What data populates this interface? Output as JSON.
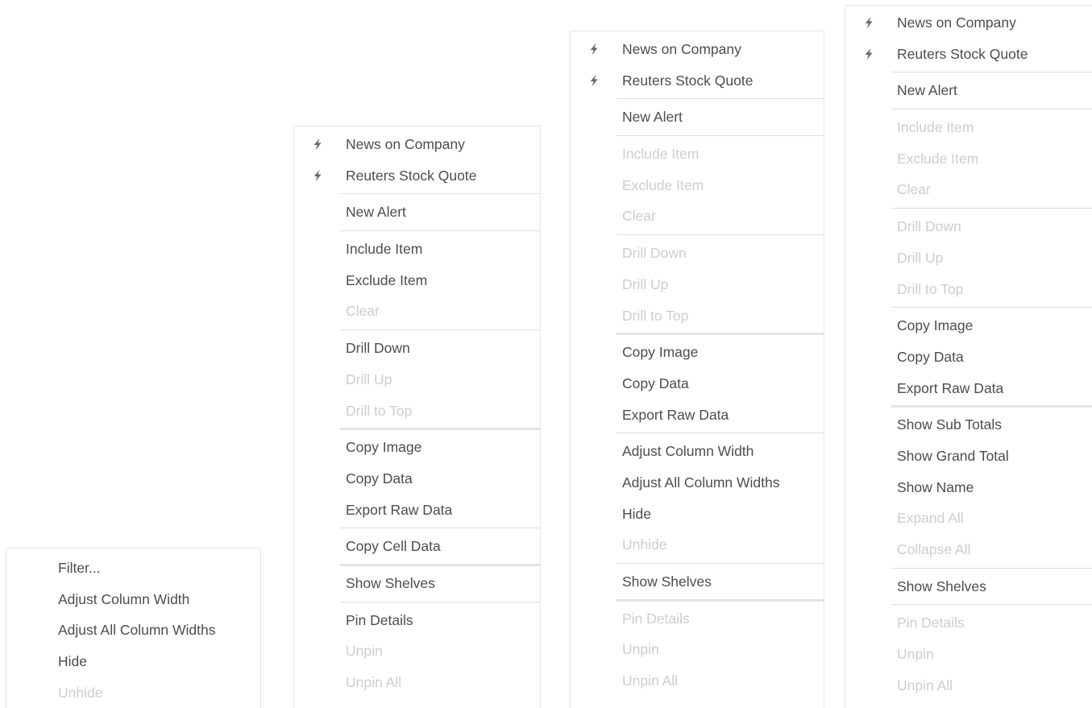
{
  "menus": [
    {
      "id": "menu-1",
      "items": [
        {
          "type": "item",
          "label": "Filter...",
          "enabled": true
        },
        {
          "type": "item",
          "label": "Adjust Column Width",
          "enabled": true
        },
        {
          "type": "item",
          "label": "Adjust All Column Widths",
          "enabled": true
        },
        {
          "type": "item",
          "label": "Hide",
          "enabled": true
        },
        {
          "type": "item",
          "label": "Unhide",
          "enabled": false
        }
      ]
    },
    {
      "id": "menu-2",
      "items": [
        {
          "type": "item",
          "label": "News on Company",
          "enabled": true,
          "icon": "lightning-icon"
        },
        {
          "type": "item",
          "label": "Reuters Stock Quote",
          "enabled": true,
          "icon": "lightning-icon"
        },
        {
          "type": "sep"
        },
        {
          "type": "item",
          "label": "New Alert",
          "enabled": true
        },
        {
          "type": "sep"
        },
        {
          "type": "item",
          "label": "Include Item",
          "enabled": true
        },
        {
          "type": "item",
          "label": "Exclude Item",
          "enabled": true
        },
        {
          "type": "item",
          "label": "Clear",
          "enabled": false
        },
        {
          "type": "sep"
        },
        {
          "type": "item",
          "label": "Drill Down",
          "enabled": true
        },
        {
          "type": "item",
          "label": "Drill Up",
          "enabled": false
        },
        {
          "type": "item",
          "label": "Drill to Top",
          "enabled": false
        },
        {
          "type": "sep",
          "style": "thick"
        },
        {
          "type": "item",
          "label": "Copy Image",
          "enabled": true
        },
        {
          "type": "item",
          "label": "Copy Data",
          "enabled": true
        },
        {
          "type": "item",
          "label": "Export Raw Data",
          "enabled": true
        },
        {
          "type": "sep"
        },
        {
          "type": "item",
          "label": "Copy Cell Data",
          "enabled": true
        },
        {
          "type": "sep",
          "style": "thick"
        },
        {
          "type": "item",
          "label": "Show Shelves",
          "enabled": true
        },
        {
          "type": "sep"
        },
        {
          "type": "item",
          "label": "Pin Details",
          "enabled": true
        },
        {
          "type": "item",
          "label": "Unpin",
          "enabled": false
        },
        {
          "type": "item",
          "label": "Unpin All",
          "enabled": false
        }
      ]
    },
    {
      "id": "menu-3",
      "items": [
        {
          "type": "item",
          "label": "News on Company",
          "enabled": true,
          "icon": "lightning-icon"
        },
        {
          "type": "item",
          "label": "Reuters Stock Quote",
          "enabled": true,
          "icon": "lightning-icon"
        },
        {
          "type": "sep"
        },
        {
          "type": "item",
          "label": "New Alert",
          "enabled": true
        },
        {
          "type": "sep"
        },
        {
          "type": "item",
          "label": "Include Item",
          "enabled": false
        },
        {
          "type": "item",
          "label": "Exclude Item",
          "enabled": false
        },
        {
          "type": "item",
          "label": "Clear",
          "enabled": false
        },
        {
          "type": "sep"
        },
        {
          "type": "item",
          "label": "Drill Down",
          "enabled": false
        },
        {
          "type": "item",
          "label": "Drill Up",
          "enabled": false
        },
        {
          "type": "item",
          "label": "Drill to Top",
          "enabled": false
        },
        {
          "type": "sep",
          "style": "thick"
        },
        {
          "type": "item",
          "label": "Copy Image",
          "enabled": true
        },
        {
          "type": "item",
          "label": "Copy Data",
          "enabled": true
        },
        {
          "type": "item",
          "label": "Export Raw Data",
          "enabled": true
        },
        {
          "type": "sep"
        },
        {
          "type": "item",
          "label": "Adjust Column Width",
          "enabled": true
        },
        {
          "type": "item",
          "label": "Adjust All Column Widths",
          "enabled": true
        },
        {
          "type": "item",
          "label": "Hide",
          "enabled": true
        },
        {
          "type": "item",
          "label": "Unhide",
          "enabled": false
        },
        {
          "type": "sep"
        },
        {
          "type": "item",
          "label": "Show Shelves",
          "enabled": true
        },
        {
          "type": "sep",
          "style": "thick"
        },
        {
          "type": "item",
          "label": "Pin Details",
          "enabled": false
        },
        {
          "type": "item",
          "label": "Unpin",
          "enabled": false
        },
        {
          "type": "item",
          "label": "Unpin All",
          "enabled": false
        }
      ]
    },
    {
      "id": "menu-4",
      "items": [
        {
          "type": "item",
          "label": "News on Company",
          "enabled": true,
          "icon": "lightning-icon"
        },
        {
          "type": "item",
          "label": "Reuters Stock Quote",
          "enabled": true,
          "icon": "lightning-icon"
        },
        {
          "type": "sep"
        },
        {
          "type": "item",
          "label": "New Alert",
          "enabled": true
        },
        {
          "type": "sep"
        },
        {
          "type": "item",
          "label": "Include Item",
          "enabled": false
        },
        {
          "type": "item",
          "label": "Exclude Item",
          "enabled": false
        },
        {
          "type": "item",
          "label": "Clear",
          "enabled": false
        },
        {
          "type": "sep"
        },
        {
          "type": "item",
          "label": "Drill Down",
          "enabled": false
        },
        {
          "type": "item",
          "label": "Drill Up",
          "enabled": false
        },
        {
          "type": "item",
          "label": "Drill to Top",
          "enabled": false
        },
        {
          "type": "sep"
        },
        {
          "type": "item",
          "label": "Copy Image",
          "enabled": true
        },
        {
          "type": "item",
          "label": "Copy Data",
          "enabled": true
        },
        {
          "type": "item",
          "label": "Export Raw Data",
          "enabled": true
        },
        {
          "type": "sep",
          "style": "thick"
        },
        {
          "type": "item",
          "label": "Show Sub Totals",
          "enabled": true
        },
        {
          "type": "item",
          "label": "Show Grand Total",
          "enabled": true
        },
        {
          "type": "item",
          "label": "Show Name",
          "enabled": true
        },
        {
          "type": "item",
          "label": "Expand All",
          "enabled": false
        },
        {
          "type": "item",
          "label": "Collapse All",
          "enabled": false
        },
        {
          "type": "sep"
        },
        {
          "type": "item",
          "label": "Show Shelves",
          "enabled": true
        },
        {
          "type": "sep"
        },
        {
          "type": "item",
          "label": "Pin Details",
          "enabled": false
        },
        {
          "type": "item",
          "label": "Unpin",
          "enabled": false
        },
        {
          "type": "item",
          "label": "Unpin All",
          "enabled": false
        }
      ]
    }
  ],
  "colors": {
    "enabled_text": "#4d4d4d",
    "disabled_text": "#cdcdcd",
    "separator": "#dedede",
    "border": "#e6e6e6"
  }
}
